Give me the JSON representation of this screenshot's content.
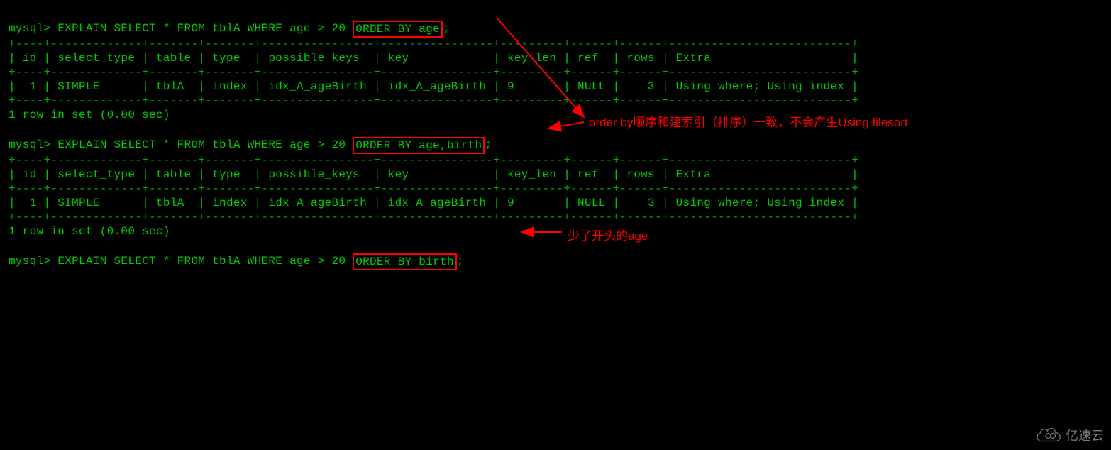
{
  "terminal": {
    "prompt": "mysql> ",
    "query1_prefix": "EXPLAIN SELECT * FROM tblA WHERE age > 20 ",
    "query1_highlight": "ORDER BY age",
    "query1_suffix": ";",
    "query2_prefix": "EXPLAIN SELECT * FROM tblA WHERE age > 20 ",
    "query2_highlight": "ORDER BY age,birth",
    "query2_suffix": ";",
    "query3_prefix": "EXPLAIN SELECT * FROM tblA WHERE age > 20 ",
    "query3_highlight": "ORDER BY birth",
    "query3_suffix": ";",
    "divider": "+----+-------------+-------+-------+----------------+----------------+---------+------+------+--------------------------+",
    "header_row": "| id | select_type | table | type  | possible_keys  | key            | key_len | ref  | rows | Extra                    |",
    "data_row": "|  1 | SIMPLE      | tblA  | index | idx_A_ageBirth | idx_A_ageBirth | 9       | NULL |    3 | Using where; Using index |",
    "result_msg": "1 row in set (0.00 sec)",
    "blank": ""
  },
  "annotations": {
    "note1": "order by顺序和建索引（排序）一致，不会产生Using filesort",
    "note2": "少了开头的age"
  },
  "watermark": {
    "text": "亿速云"
  },
  "chart_data": {
    "type": "table",
    "tables": [
      {
        "query": "EXPLAIN SELECT * FROM tblA WHERE age > 20 ORDER BY age;",
        "columns": [
          "id",
          "select_type",
          "table",
          "type",
          "possible_keys",
          "key",
          "key_len",
          "ref",
          "rows",
          "Extra"
        ],
        "rows": [
          [
            "1",
            "SIMPLE",
            "tblA",
            "index",
            "idx_A_ageBirth",
            "idx_A_ageBirth",
            "9",
            "NULL",
            "3",
            "Using where; Using index"
          ]
        ],
        "result": "1 row in set (0.00 sec)"
      },
      {
        "query": "EXPLAIN SELECT * FROM tblA WHERE age > 20 ORDER BY age,birth;",
        "columns": [
          "id",
          "select_type",
          "table",
          "type",
          "possible_keys",
          "key",
          "key_len",
          "ref",
          "rows",
          "Extra"
        ],
        "rows": [
          [
            "1",
            "SIMPLE",
            "tblA",
            "index",
            "idx_A_ageBirth",
            "idx_A_ageBirth",
            "9",
            "NULL",
            "3",
            "Using where; Using index"
          ]
        ],
        "result": "1 row in set (0.00 sec)"
      }
    ]
  }
}
